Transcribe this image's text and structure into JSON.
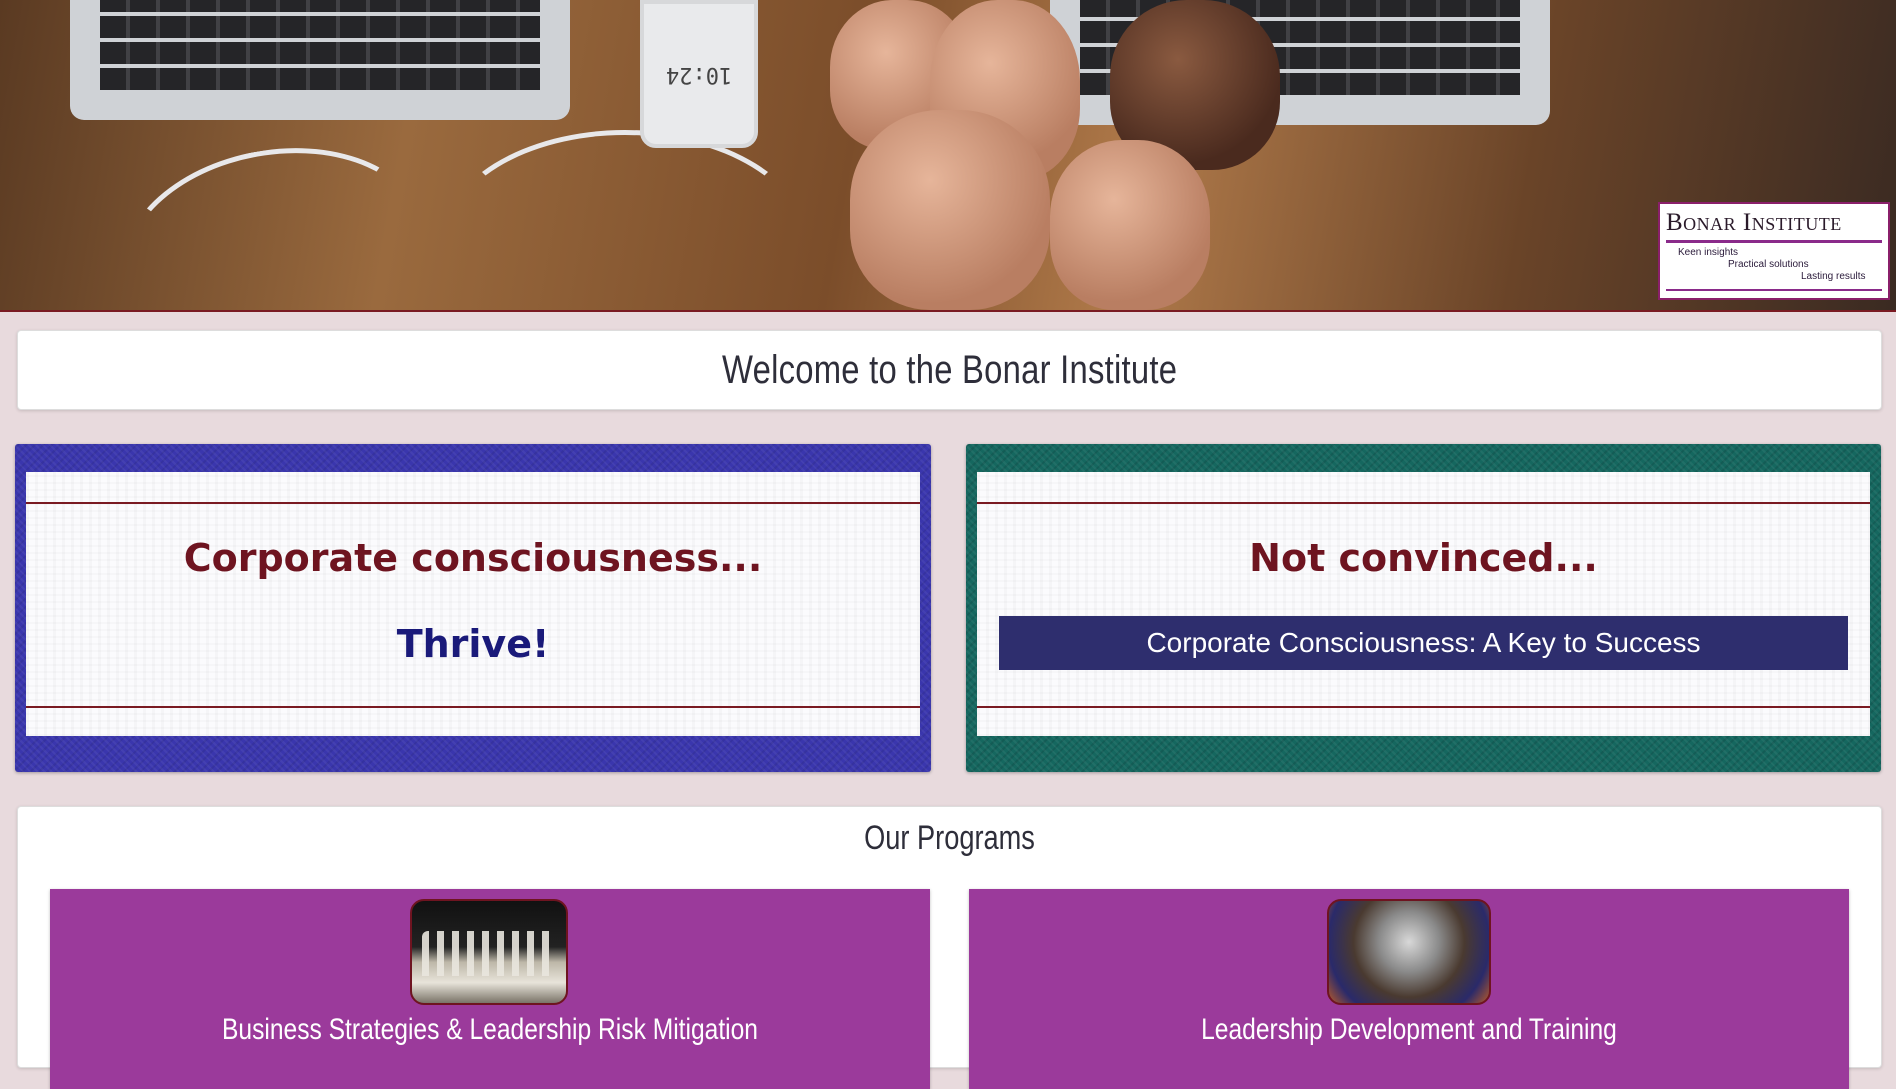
{
  "hero": {
    "phone_time": "10:24",
    "logo": {
      "name": "Bonar Institute",
      "tagline_1": "Keen insights",
      "tagline_2": "Practical solutions",
      "tagline_3": "Lasting results"
    }
  },
  "welcome": {
    "title": "Welcome to the Bonar Institute"
  },
  "panels": {
    "left": {
      "heading": "Corporate consciousness...",
      "subheading": "Thrive!",
      "color": "#3a36ad"
    },
    "right": {
      "heading": "Not convinced...",
      "button_label": "Corporate Consciousness: A Key to Success",
      "color": "#15675f"
    }
  },
  "programs": {
    "title": "Our Programs",
    "items": [
      {
        "label": "Business Strategies & Leadership Risk Mitigation",
        "image": "chess-pieces"
      },
      {
        "label": "Leadership Development and Training",
        "image": "clock-blur"
      }
    ],
    "color": "#9b3a9b"
  }
}
